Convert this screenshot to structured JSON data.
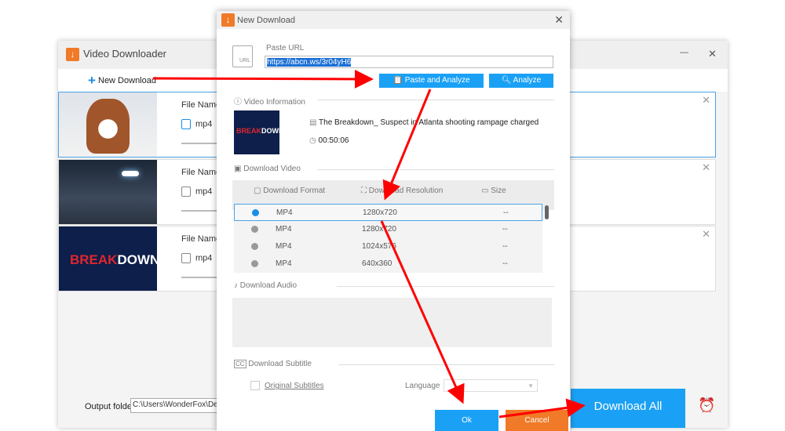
{
  "main_window": {
    "title": "Video Downloader",
    "new_download": "New Download",
    "minimize": "—",
    "close": "✕",
    "items": [
      {
        "file_name_label": "File Name:",
        "format": "mp4"
      },
      {
        "file_name_label": "File Name:",
        "format": "mp4"
      },
      {
        "file_name_label": "File Name:",
        "format": "mp4"
      }
    ],
    "thumb3_text": {
      "a": "BREAK",
      "b": "DOWN"
    },
    "output_folder_label": "Output folder:",
    "output_folder_value": "C:\\Users\\WonderFox\\Desktop",
    "download_all": "Download All"
  },
  "dialog": {
    "title": "New Download",
    "paste_url_label": "Paste URL",
    "url_value": "https://abcn.ws/3r04yH6",
    "url_icon_text": "URL",
    "paste_analyze": "Paste and Analyze",
    "analyze": "Analyze",
    "video_info_label": "Video Information",
    "video_title": "The Breakdown_ Suspect in Atlanta shooting rampage charged",
    "duration": "00:50:06",
    "download_video_label": "Download Video",
    "columns": {
      "format": "Download Format",
      "resolution": "Download Resolution",
      "size": "Size"
    },
    "rows": [
      {
        "format": "MP4",
        "resolution": "1280x720",
        "size": "--",
        "selected": true
      },
      {
        "format": "MP4",
        "resolution": "1280x720",
        "size": "--",
        "selected": false
      },
      {
        "format": "MP4",
        "resolution": "1024x576",
        "size": "--",
        "selected": false
      },
      {
        "format": "MP4",
        "resolution": "640x360",
        "size": "--",
        "selected": false
      }
    ],
    "download_audio_label": "Download Audio",
    "download_subtitle_label": "Download Subtitle",
    "original_subtitles": "Original Subtitles",
    "language_label": "Language",
    "ok": "Ok",
    "cancel": "Cancel"
  },
  "colors": {
    "accent": "#1aa1f5",
    "annotation": "#ff0000",
    "cancel": "#f07a28"
  }
}
